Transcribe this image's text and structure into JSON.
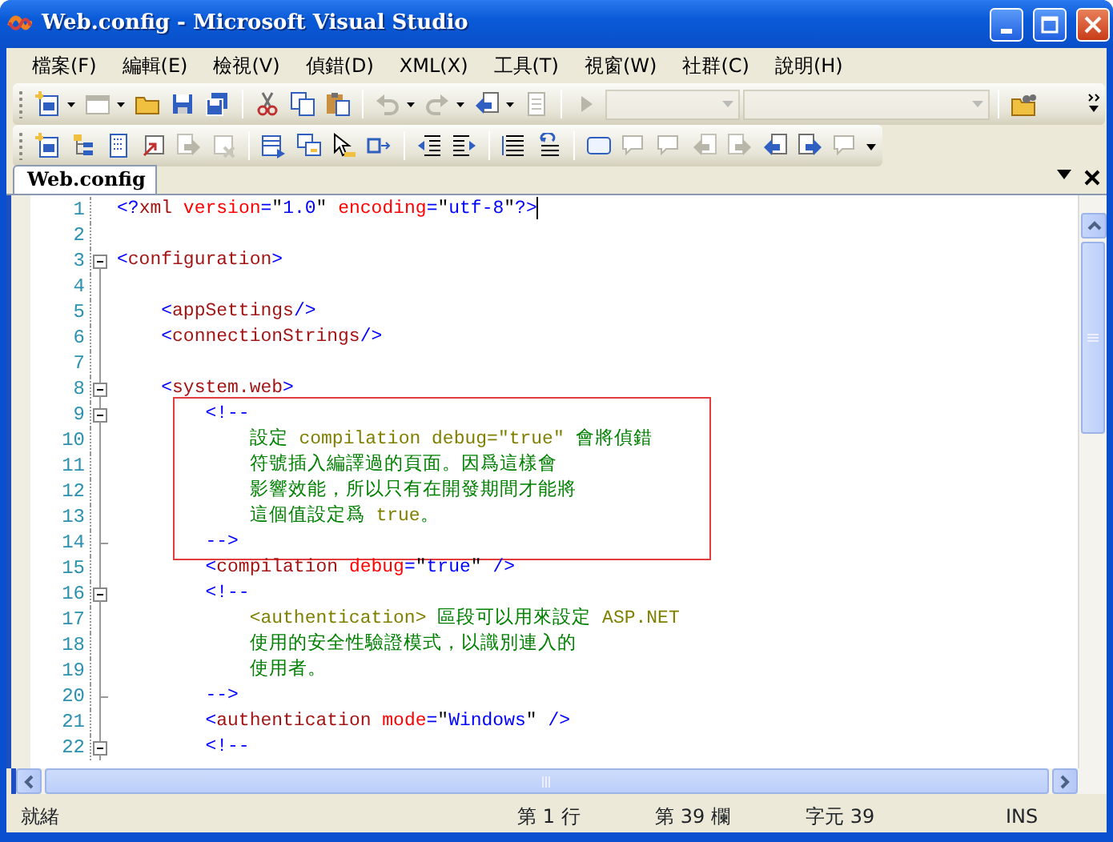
{
  "window": {
    "title": "Web.config - Microsoft Visual Studio"
  },
  "menu": [
    "檔案(F)",
    "編輯(E)",
    "檢視(V)",
    "偵錯(D)",
    "XML(X)",
    "工具(T)",
    "視窗(W)",
    "社群(C)",
    "說明(H)"
  ],
  "toolbar_1": [
    {
      "kind": "split",
      "disabled": false
    },
    {
      "kind": "split",
      "disabled": true
    },
    {
      "kind": "button",
      "disabled": false
    },
    {
      "kind": "button",
      "disabled": false
    },
    {
      "kind": "button",
      "disabled": false
    },
    {
      "kind": "separator"
    },
    {
      "kind": "button",
      "disabled": false
    },
    {
      "kind": "button",
      "disabled": false
    },
    {
      "kind": "button",
      "disabled": false
    },
    {
      "kind": "separator"
    },
    {
      "kind": "split",
      "disabled": true
    },
    {
      "kind": "split",
      "disabled": true
    },
    {
      "kind": "split",
      "disabled": false
    },
    {
      "kind": "button",
      "disabled": true
    },
    {
      "kind": "separator"
    },
    {
      "kind": "button",
      "disabled": true
    },
    {
      "kind": "combo",
      "disabled": true
    },
    {
      "kind": "combo",
      "disabled": true
    },
    {
      "kind": "separator"
    },
    {
      "kind": "button",
      "disabled": false
    }
  ],
  "toolbar_2": [
    {
      "kind": "button",
      "disabled": false
    },
    {
      "kind": "button",
      "disabled": false
    },
    {
      "kind": "button",
      "disabled": false
    },
    {
      "kind": "button",
      "disabled": false
    },
    {
      "kind": "button",
      "disabled": true
    },
    {
      "kind": "button",
      "disabled": true
    },
    {
      "kind": "separator"
    },
    {
      "kind": "button",
      "disabled": false
    },
    {
      "kind": "button",
      "disabled": false
    },
    {
      "kind": "button",
      "disabled": false
    },
    {
      "kind": "button",
      "disabled": false
    },
    {
      "kind": "separator"
    },
    {
      "kind": "button",
      "disabled": false
    },
    {
      "kind": "button",
      "disabled": false
    },
    {
      "kind": "separator"
    },
    {
      "kind": "button",
      "disabled": false
    },
    {
      "kind": "button",
      "disabled": false
    },
    {
      "kind": "separator"
    },
    {
      "kind": "button",
      "disabled": false
    },
    {
      "kind": "button",
      "disabled": true
    },
    {
      "kind": "button",
      "disabled": true
    },
    {
      "kind": "button",
      "disabled": true
    },
    {
      "kind": "button",
      "disabled": true
    },
    {
      "kind": "button",
      "disabled": false
    },
    {
      "kind": "button",
      "disabled": false
    },
    {
      "kind": "button",
      "disabled": true
    }
  ],
  "tabs": [
    {
      "label": "Web.config",
      "selected": true
    }
  ],
  "editor": {
    "blocks": [
      {
        "boxed": false,
        "lines": [
          {
            "number": "1",
            "kind": "plain",
            "caret": true,
            "tokens": [
              {
                "kind": "delim",
                "text": "<?"
              },
              {
                "kind": "tag",
                "text": "xml"
              },
              {
                "kind": "attr",
                "text": " version"
              },
              {
                "kind": "delim",
                "text": "="
              },
              {
                "kind": "plain",
                "text": "\""
              },
              {
                "kind": "value",
                "text": "1.0"
              },
              {
                "kind": "plain",
                "text": "\""
              },
              {
                "kind": "attr",
                "text": " encoding"
              },
              {
                "kind": "delim",
                "text": "="
              },
              {
                "kind": "plain",
                "text": "\""
              },
              {
                "kind": "value",
                "text": "utf-8"
              },
              {
                "kind": "plain",
                "text": "\""
              },
              {
                "kind": "delim",
                "text": "?>"
              }
            ]
          },
          {
            "number": "2",
            "kind": "plain"
          },
          {
            "number": "3",
            "kind": "fold-start",
            "tokens": [
              {
                "kind": "delim",
                "text": "<"
              },
              {
                "kind": "tag",
                "text": "configuration"
              },
              {
                "kind": "delim",
                "text": ">"
              }
            ]
          },
          {
            "number": "4",
            "kind": "plain"
          },
          {
            "number": "5",
            "kind": "plain",
            "tokens": [
              {
                "kind": "delim",
                "text": "    <"
              },
              {
                "kind": "tag",
                "text": "appSettings"
              },
              {
                "kind": "delim",
                "text": "/>"
              }
            ]
          },
          {
            "number": "6",
            "kind": "plain",
            "tokens": [
              {
                "kind": "delim",
                "text": "    <"
              },
              {
                "kind": "tag",
                "text": "connectionStrings"
              },
              {
                "kind": "delim",
                "text": "/>"
              }
            ]
          },
          {
            "number": "7",
            "kind": "plain"
          },
          {
            "number": "8",
            "kind": "fold-start",
            "tokens": [
              {
                "kind": "delim",
                "text": "    <"
              },
              {
                "kind": "tag",
                "text": "system.web"
              },
              {
                "kind": "delim",
                "text": ">"
              }
            ]
          }
        ]
      },
      {
        "boxed": true,
        "lines": [
          {
            "number": "9",
            "kind": "fold-start",
            "tokens": [
              {
                "kind": "delim",
                "text": "        <!--"
              }
            ]
          },
          {
            "number": "10",
            "kind": "plain",
            "tokens": [
              {
                "kind": "comment",
                "text": "            設定 "
              },
              {
                "kind": "comment-xml",
                "text": "compilation debug=\"true\""
              },
              {
                "kind": "comment",
                "text": " 會將偵錯"
              }
            ]
          },
          {
            "number": "11",
            "kind": "plain",
            "tokens": [
              {
                "kind": "comment",
                "text": "            符號插入編譯過的頁面。因爲這樣會"
              }
            ]
          },
          {
            "number": "12",
            "kind": "plain",
            "tokens": [
              {
                "kind": "comment",
                "text": "            影響效能，所以只有在開發期間才能將"
              }
            ]
          },
          {
            "number": "13",
            "kind": "plain",
            "tokens": [
              {
                "kind": "comment",
                "text": "            這個值設定爲 "
              },
              {
                "kind": "comment-xml",
                "text": "true"
              },
              {
                "kind": "comment",
                "text": "。"
              }
            ]
          },
          {
            "number": "14",
            "kind": "fold-end",
            "tokens": [
              {
                "kind": "delim",
                "text": "        -->"
              }
            ]
          }
        ]
      },
      {
        "boxed": false,
        "lines": [
          {
            "number": "15",
            "kind": "plain",
            "tokens": [
              {
                "kind": "delim",
                "text": "        <"
              },
              {
                "kind": "tag",
                "text": "compilation"
              },
              {
                "kind": "attr",
                "text": " debug"
              },
              {
                "kind": "delim",
                "text": "="
              },
              {
                "kind": "plain",
                "text": "\""
              },
              {
                "kind": "value",
                "text": "true"
              },
              {
                "kind": "plain",
                "text": "\""
              },
              {
                "kind": "delim",
                "text": " />"
              }
            ]
          },
          {
            "number": "16",
            "kind": "fold-start",
            "tokens": [
              {
                "kind": "delim",
                "text": "        <!--"
              }
            ]
          },
          {
            "number": "17",
            "kind": "plain",
            "tokens": [
              {
                "kind": "comment-xml",
                "text": "            <authentication>"
              },
              {
                "kind": "comment",
                "text": " 區段可以用來設定 "
              },
              {
                "kind": "comment-xml",
                "text": "ASP.NET"
              }
            ]
          },
          {
            "number": "18",
            "kind": "plain",
            "tokens": [
              {
                "kind": "comment",
                "text": "            使用的安全性驗證模式，以識別連入的"
              }
            ]
          },
          {
            "number": "19",
            "kind": "plain",
            "tokens": [
              {
                "kind": "comment",
                "text": "            使用者。"
              }
            ]
          },
          {
            "number": "20",
            "kind": "fold-end",
            "tokens": [
              {
                "kind": "delim",
                "text": "        -->"
              }
            ]
          },
          {
            "number": "21",
            "kind": "plain",
            "tokens": [
              {
                "kind": "delim",
                "text": "        <"
              },
              {
                "kind": "tag",
                "text": "authentication"
              },
              {
                "kind": "attr",
                "text": " mode"
              },
              {
                "kind": "delim",
                "text": "="
              },
              {
                "kind": "plain",
                "text": "\""
              },
              {
                "kind": "value",
                "text": "Windows"
              },
              {
                "kind": "plain",
                "text": "\""
              },
              {
                "kind": "delim",
                "text": " />"
              }
            ]
          },
          {
            "number": "22",
            "kind": "fold-start",
            "tokens": [
              {
                "kind": "delim",
                "text": "        <!--"
              }
            ]
          }
        ]
      }
    ]
  },
  "status_bar": [
    {
      "kind": "message",
      "text": "就緒"
    },
    {
      "kind": "line",
      "text": "第 1 行"
    },
    {
      "kind": "column",
      "text": "第 39 欄"
    },
    {
      "kind": "char",
      "text": "字元 39"
    },
    {
      "kind": "mode",
      "text": "INS"
    }
  ]
}
